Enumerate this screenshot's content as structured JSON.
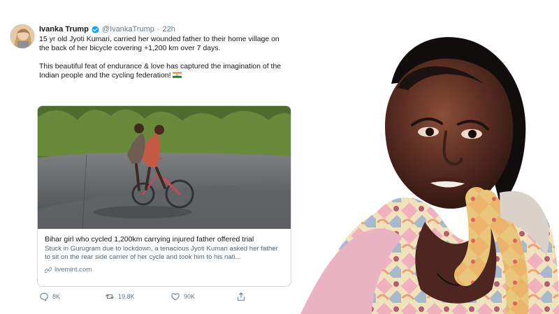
{
  "tweet": {
    "author": "Ivanka Trump",
    "handle": "@IvankaTrump",
    "separator": "·",
    "time": "22h",
    "text_1": "15 yr old Jyoti Kumari, carried her wounded father to their home village on the back of her bicycle covering +1,200 km over 7 days.",
    "text_2": "This beautiful feat of endurance & love has captured the imagination of the Indian people and the cycling federation!",
    "flag_icon": "india-flag-icon",
    "card": {
      "title": "Bihar girl who cycled 1,200km carrying injured father offered trial",
      "description": "Stuck in Gurugram due to lockdown, a tenacious Jyoti Kumari asked her father to sit on the rear side carrier of her cycle and took him to his nati...",
      "domain": "livemint.com"
    },
    "actions": {
      "reply_count": "8K",
      "retweet_count": "19.8K",
      "like_count": "90K"
    }
  },
  "colors": {
    "verified": "#1da1f2",
    "text": "#14171a",
    "muted": "#657786",
    "border": "#cfd9de"
  },
  "icons": [
    "verified-icon",
    "link-icon",
    "reply-icon",
    "retweet-icon",
    "like-icon",
    "share-icon"
  ]
}
